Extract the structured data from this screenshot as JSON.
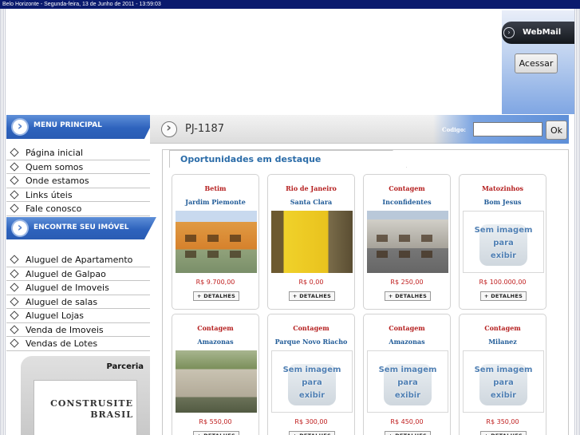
{
  "topbar": {
    "text": "Belo Horizonte - Segunda-feira, 13 de Junho de 2011   - 13:59:03"
  },
  "webmail": {
    "title": "WebMail",
    "button": "Acessar"
  },
  "menu": {
    "title": "MENU PRINCIPAL",
    "items": [
      "Página inicial",
      "Quem somos",
      "Onde estamos",
      "Links úteis",
      "Fale conosco"
    ]
  },
  "find": {
    "title": "ENCONTRE SEU IMÓVEL",
    "items": [
      "Aluguel de Apartamento",
      "Aluguel de Galpao",
      "Aluguel de Imoveis",
      "Aluguel de salas",
      "Aluguel Lojas",
      "Venda de Imoveis",
      "Vendas de Lotes"
    ]
  },
  "parceria": {
    "title": "Parceria",
    "logo_line1": "CONSTRUSITE",
    "logo_line2": "BRASIL"
  },
  "codebar": {
    "ref": "PJ-1187",
    "codigo_label": "Codigo:",
    "ok": "Ok"
  },
  "featured": {
    "title": "Oportunidades em destaque",
    "details_label": "+ DETALHES",
    "no_image_lines": [
      "Sem imagem",
      "para",
      "exibir"
    ],
    "cards": [
      {
        "city": "Betim",
        "hood": "Jardim Piemonte",
        "price": "R$ 9.700,00",
        "photo": "orange"
      },
      {
        "city": "Rio de Janeiro",
        "hood": "Santa Clara",
        "price": "R$ 0,00",
        "photo": "yellow"
      },
      {
        "city": "Contagem",
        "hood": "Inconfidentes",
        "price": "R$ 250,00",
        "photo": "grey"
      },
      {
        "city": "Matozinhos",
        "hood": "Bom Jesus",
        "price": "R$ 100.000,00",
        "photo": "none"
      },
      {
        "city": "Contagem",
        "hood": "Amazonas",
        "price": "R$ 550,00",
        "photo": "green"
      },
      {
        "city": "Contagem",
        "hood": "Parque Novo Riacho",
        "price": "R$ 300,00",
        "photo": "none"
      },
      {
        "city": "Contagem",
        "hood": "Amazonas",
        "price": "R$ 450,00",
        "photo": "none"
      },
      {
        "city": "Contagem",
        "hood": "Milanez",
        "price": "R$ 350,00",
        "photo": "none"
      }
    ]
  }
}
